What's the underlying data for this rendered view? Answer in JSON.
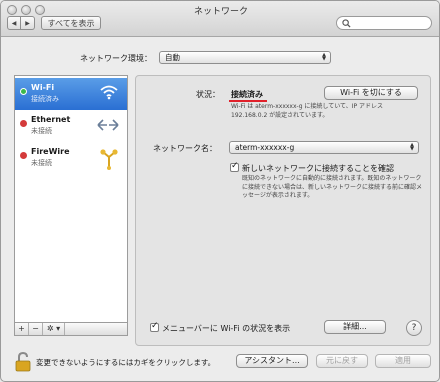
{
  "window": {
    "title": "ネットワーク"
  },
  "toolbar": {
    "back": "◀",
    "forward": "▶",
    "show_all": "すべてを表示",
    "search_placeholder": ""
  },
  "location": {
    "label": "ネットワーク環境：",
    "value": "自動"
  },
  "services": [
    {
      "name": "Wi-Fi",
      "status": "接続済み",
      "dot_color": "#3cb94b",
      "icon": "wifi-icon",
      "selected": true
    },
    {
      "name": "Ethernet",
      "status": "未接続",
      "dot_color": "#d43a3a",
      "icon": "ethernet-icon",
      "selected": false
    },
    {
      "name": "FireWire",
      "status": "未接続",
      "dot_color": "#d43a3a",
      "icon": "firewire-icon",
      "selected": false
    }
  ],
  "sidebar_footer": {
    "add": "+",
    "remove": "−",
    "gear": "✲ ▾"
  },
  "panel": {
    "status_label": "状況：",
    "status_value": "接続済み",
    "wifi_off_button": "Wi-Fi を切にする",
    "status_desc": "Wi-Fi は aterm-xxxxxx-g に接続していて、IP アドレス 192.168.0.2 が設定されています。",
    "network_name_label": "ネットワーク名：",
    "network_name_value": "aterm-xxxxxx-g",
    "ask_join_label": "新しいネットワークに接続することを確認",
    "ask_join_desc": "既知のネットワークに自動的に接続されます。既知のネットワークに接続できない場合は、新しいネットワークに接続する前に確認メッセージが表示されます。",
    "show_menubar_label": "メニューバーに Wi-Fi の状況を表示",
    "advanced_button": "詳細...",
    "help_button": "?"
  },
  "footer": {
    "lock_text": "変更できないようにするにはカギをクリックします。",
    "assist_button": "アシスタント...",
    "revert_button": "元に戻す",
    "apply_button": "適用"
  }
}
